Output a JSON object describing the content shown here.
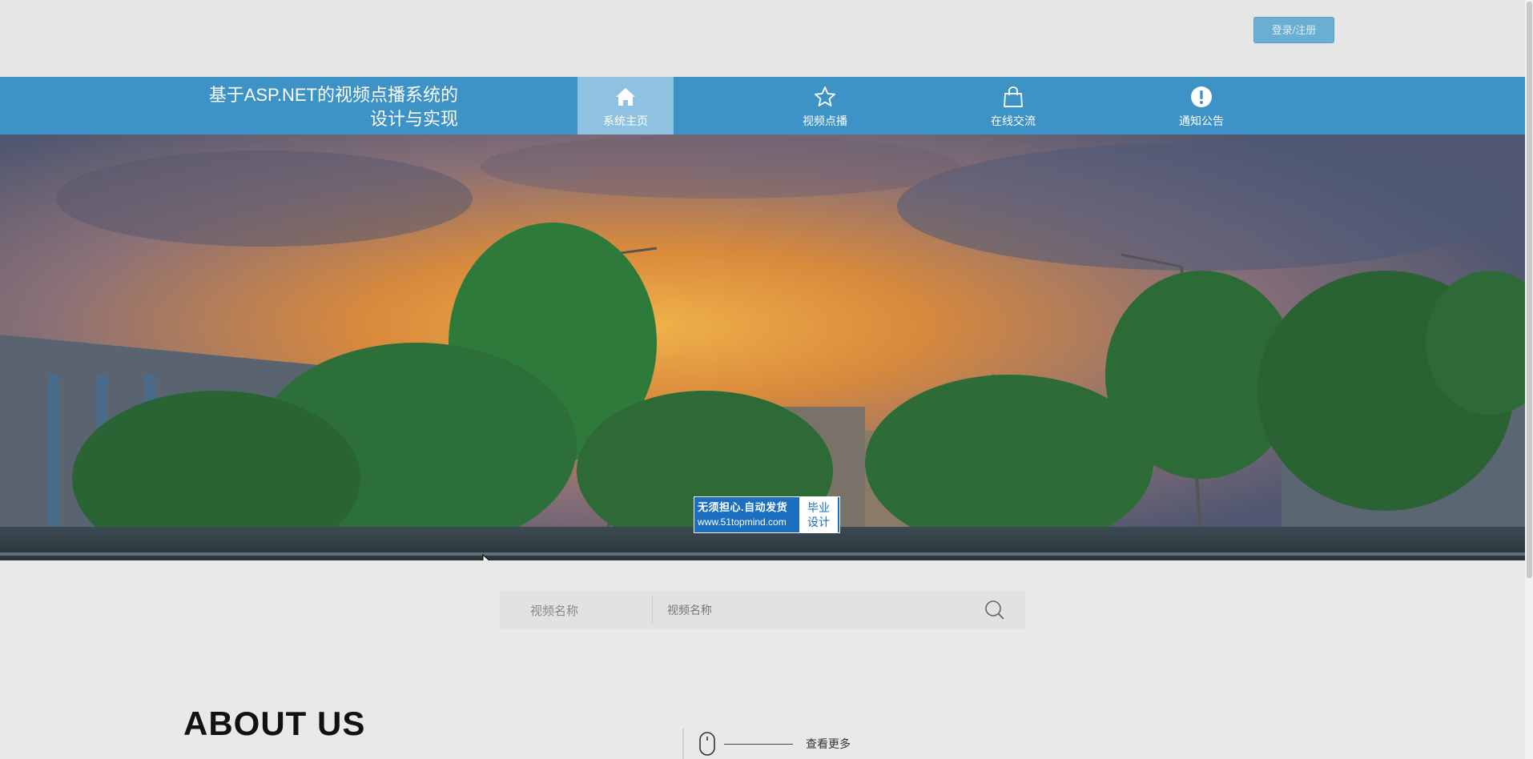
{
  "header": {
    "login_register": "登录/注册"
  },
  "site": {
    "title_line1": "基于ASP.NET的视频点播系统的",
    "title_line2": "设计与实现"
  },
  "nav": {
    "items": [
      {
        "label": "系统主页",
        "icon": "home-icon",
        "active": true
      },
      {
        "label": "视频点播",
        "icon": "star-icon",
        "active": false
      },
      {
        "label": "在线交流",
        "icon": "shopping-bag-icon",
        "active": false
      },
      {
        "label": "通知公告",
        "icon": "exclamation-circle-icon",
        "active": false
      }
    ]
  },
  "banner": {
    "watermark_line1": "无须担心.自动发货",
    "watermark_line2": "www.51topmind.com",
    "watermark_badge_line1": "毕业",
    "watermark_badge_line2": "设计"
  },
  "search": {
    "label": "视频名称",
    "placeholder": "视频名称"
  },
  "about": {
    "title": "ABOUT US",
    "more_label": "查看更多"
  },
  "colors": {
    "nav_bg": "#3d92c6",
    "nav_active": "#8fc2e0",
    "login_btn": "#6aaed3",
    "page_bg": "#e9e9e9"
  }
}
